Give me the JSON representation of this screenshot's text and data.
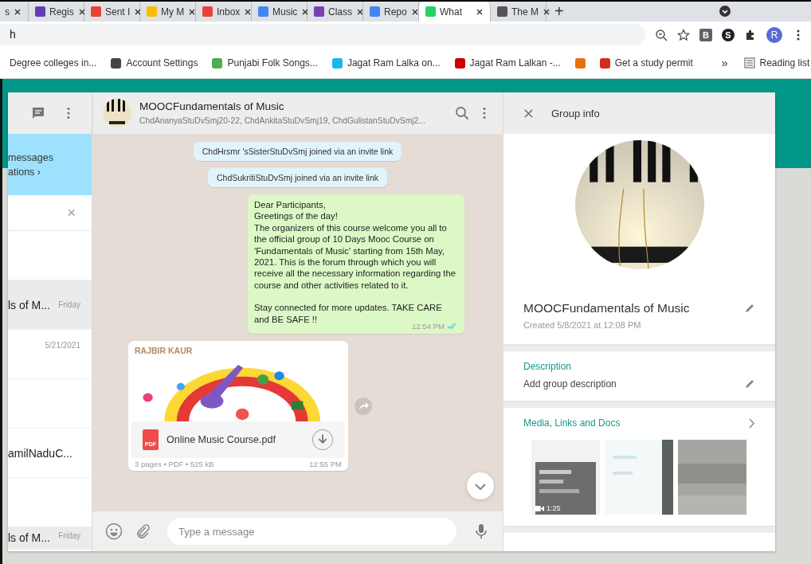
{
  "browser": {
    "tabs": [
      {
        "label": "s",
        "selected": false
      },
      {
        "label": "Regis",
        "selected": false,
        "color": "#673ab7"
      },
      {
        "label": "Sent I",
        "selected": false,
        "color": "#ea4335"
      },
      {
        "label": "My M",
        "selected": false,
        "color": "#fbbc04"
      },
      {
        "label": "Inbox",
        "selected": false,
        "color": "#ea4335"
      },
      {
        "label": "Music",
        "selected": false,
        "color": "#4285f4"
      },
      {
        "label": "Class",
        "selected": false,
        "color": "#7b3fb3"
      },
      {
        "label": "Repo",
        "selected": false,
        "color": "#4285f4"
      },
      {
        "label": "What",
        "selected": true,
        "color": "#25d366"
      },
      {
        "label": "The M",
        "selected": false,
        "color": "#555555"
      }
    ],
    "new_tab": "+",
    "address": "h",
    "extensions": [
      {
        "letter": "B",
        "color": "#5f6368"
      },
      {
        "letter": "S",
        "color": "#202124"
      }
    ],
    "profile": "R",
    "bookmarks": [
      {
        "label": "Degree colleges in..."
      },
      {
        "label": "Account Settings",
        "color": "#444444"
      },
      {
        "label": "Punjabi Folk Songs...",
        "color": "#4caf50"
      },
      {
        "label": "Jagat Ram Lalka on...",
        "color": "#1ab7ea"
      },
      {
        "label": "Jagat Ram Lalkan -...",
        "color": "#cc0000"
      },
      {
        "color": "#e8710a"
      },
      {
        "label": "Get a study permit",
        "color": "#d52b1e"
      }
    ],
    "more": "»",
    "reading_list": "Reading list"
  },
  "sidebar": {
    "banner": [
      "messages",
      "ations ›"
    ],
    "search_clear": "×",
    "chats": [
      {
        "selected": false
      },
      {
        "name": "ls of M...",
        "time": "Friday",
        "selected": true
      },
      {
        "time": "5/21/2021",
        "selected": false
      },
      {
        "selected": false
      },
      {
        "name": "amilNaduC...",
        "selected": false
      },
      {
        "selected": false
      },
      {
        "name": "ls of M...",
        "time": "Friday",
        "selected": true
      }
    ]
  },
  "chat": {
    "title": "MOOCFundamentals of Music",
    "members": "ChdAnanyaStuDvSmj20-22, ChdAnkitaStuDvSmj19, ChdGulistanStuDvSmj2...",
    "messages": [
      {
        "kind": "system",
        "text": "ChdHrsmr 'sSisterStuDvSmj joined via an invite link"
      },
      {
        "kind": "system",
        "text": "ChdSukritiStuDvSmj joined via an invite link"
      },
      {
        "kind": "outgoing",
        "paragraphs": [
          [
            "Dear Participants,",
            "Greetings of the day!",
            "The organizers of this course welcome you all to the official group of 10 Days Mooc Course on 'Fundamentals of Music' starting from 15th May, 2021. This is the forum through which you will receive all the necessary information regarding the course and other activities related to it."
          ],
          [
            "Stay connected for more updates. TAKE CARE and BE SAFE !!"
          ]
        ],
        "time": "12:54 PM",
        "read": true
      },
      {
        "kind": "document",
        "sender": "RAJBIR KAUR",
        "file_type": "PDF",
        "file": "Online Music Course.pdf",
        "details": "3 pages • PDF • 525 kB",
        "time": "12:55 PM"
      }
    ],
    "placeholder": "Type a message"
  },
  "group_info": {
    "title": "Group info",
    "name": "MOOCFundamentals of Music",
    "created": "Created 5/8/2021 at 12:08 PM",
    "description_heading": "Description",
    "description_placeholder": "Add group description",
    "media_heading": "Media, Links and Docs",
    "media": [
      {
        "kind": "picture",
        "duration": "1:25"
      },
      {
        "kind": "picture"
      },
      {
        "kind": "picture"
      }
    ]
  }
}
